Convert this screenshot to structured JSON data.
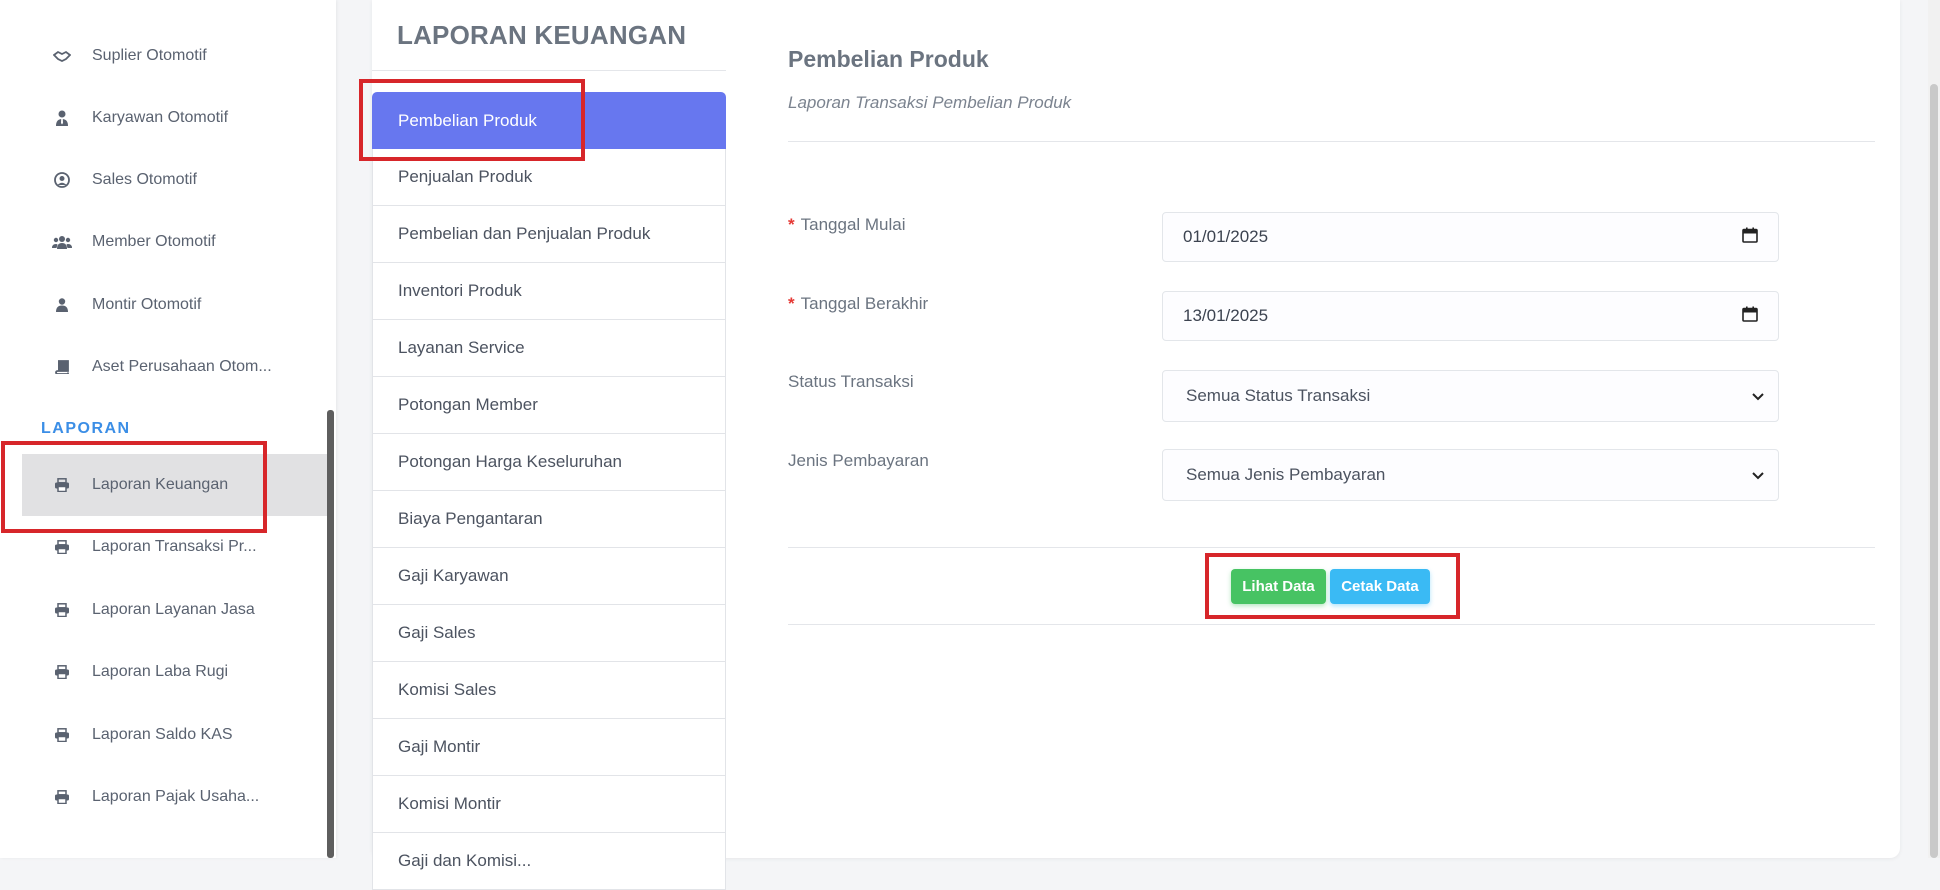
{
  "sidebar": {
    "items_top": [
      {
        "label": "Suplier Otomotif",
        "icon": "handshake-icon"
      },
      {
        "label": "Karyawan Otomotif",
        "icon": "user-tie-icon"
      },
      {
        "label": "Sales Otomotif",
        "icon": "user-circle-icon"
      },
      {
        "label": "Member Otomotif",
        "icon": "users-icon"
      },
      {
        "label": "Montir Otomotif",
        "icon": "user-icon"
      },
      {
        "label": "Aset Perusahaan Otom...",
        "icon": "book-icon"
      }
    ],
    "section_heading": "LAPORAN",
    "items_laporan": [
      {
        "label": "Laporan Keuangan",
        "icon": "print-icon"
      },
      {
        "label": "Laporan Transaksi Pr...",
        "icon": "print-icon"
      },
      {
        "label": "Laporan Layanan Jasa",
        "icon": "print-icon"
      },
      {
        "label": "Laporan Laba Rugi",
        "icon": "print-icon"
      },
      {
        "label": "Laporan Saldo KAS",
        "icon": "print-icon"
      },
      {
        "label": "Laporan Pajak Usaha...",
        "icon": "print-icon"
      }
    ]
  },
  "report_menu": {
    "title": "LAPORAN KEUANGAN",
    "items": [
      "Pembelian Produk",
      "Penjualan Produk",
      "Pembelian dan Penjualan Produk",
      "Inventori Produk",
      "Layanan Service",
      "Potongan Member",
      "Potongan Harga Keseluruhan",
      "Biaya Pengantaran",
      "Gaji Karyawan",
      "Gaji Sales",
      "Komisi Sales",
      "Gaji Montir",
      "Komisi Montir",
      "Gaji dan Komisi..."
    ],
    "active_color": "#6777ef"
  },
  "form": {
    "title": "Pembelian Produk",
    "subtitle": "Laporan Transaksi Pembelian Produk",
    "start_label": "Tanggal Mulai",
    "start_value": "01/01/2025",
    "end_label": "Tanggal Berakhir",
    "end_value": "13/01/2025",
    "required_mark": "*",
    "status_label": "Status Transaksi",
    "status_value": "Semua Status Transaksi",
    "payment_label": "Jenis Pembayaran",
    "payment_value": "Semua Jenis Pembayaran",
    "view_button": "Lihat Data",
    "print_button": "Cetak Data",
    "view_color": "#47c363",
    "print_color": "#3abaf4"
  },
  "highlight_color": "#d7262a"
}
